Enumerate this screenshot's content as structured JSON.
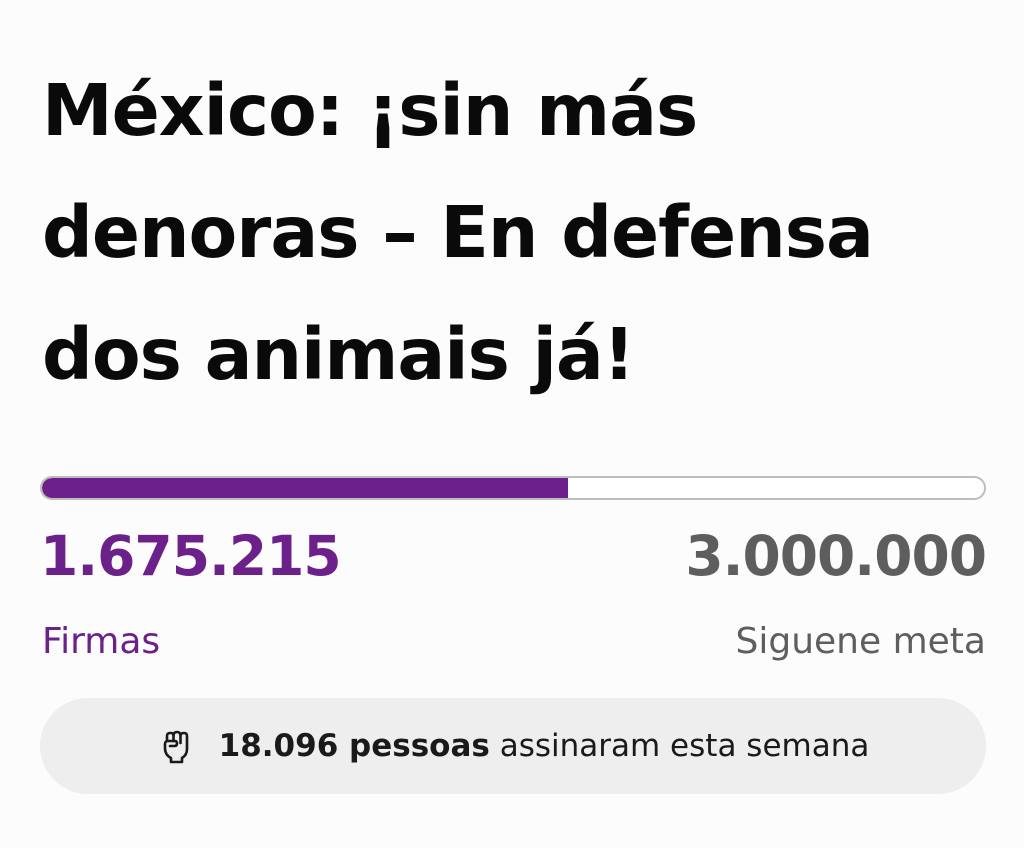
{
  "petition": {
    "title": "México: ¡sin más denoras – En defensa dos animais já!"
  },
  "progress": {
    "signatures": "1.675.215",
    "signatures_label": "Firmas",
    "goal": "3.000.000",
    "goal_label": "Siguene meta",
    "fraction": 0.558,
    "fill_color": "#6b2189",
    "track_border_color": "#bdbdbd"
  },
  "weekly": {
    "icon": "raised-fist-icon",
    "count_text": "18.096 pessoas",
    "rest_text": " assinaram esta semana",
    "background": "#eeeeee"
  },
  "colors": {
    "accent": "#6b2189",
    "muted": "#5e5e5e",
    "text": "#0a0a0a"
  }
}
